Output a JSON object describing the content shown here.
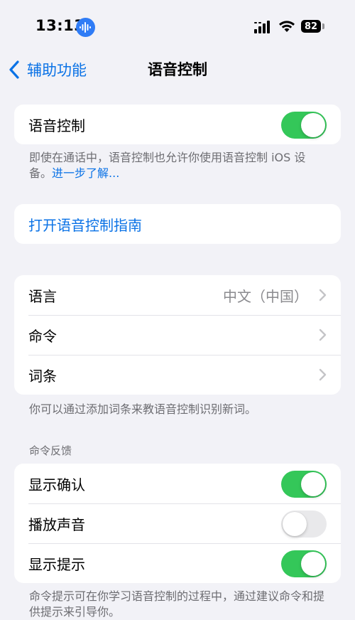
{
  "status": {
    "time": "13:13",
    "battery": "82"
  },
  "nav": {
    "back_label": "辅助功能",
    "title": "语音控制"
  },
  "voice_control": {
    "label": "语音控制",
    "toggle_on": true,
    "footnote_text": "即使在通话中，语音控制也允许你使用语音控制 iOS 设备。",
    "footnote_link": "进一步了解..."
  },
  "guide": {
    "label": "打开语音控制指南"
  },
  "settings": {
    "items": [
      {
        "label": "语言",
        "value": "中文（中国）"
      },
      {
        "label": "命令",
        "value": ""
      },
      {
        "label": "词条",
        "value": ""
      }
    ],
    "footnote": "你可以通过添加词条来教语音控制识别新词。"
  },
  "feedback": {
    "header": "命令反馈",
    "items": [
      {
        "label": "显示确认",
        "on": true
      },
      {
        "label": "播放声音",
        "on": false
      },
      {
        "label": "显示提示",
        "on": true
      }
    ],
    "footnote": "命令提示可在你学习语音控制的过程中，通过建议命令和提供提示来引导你。"
  },
  "colors": {
    "accent": "#0a72e6",
    "toggle_on": "#34c759",
    "toggle_off": "#e9e9eb",
    "background": "#f2f2f7"
  }
}
